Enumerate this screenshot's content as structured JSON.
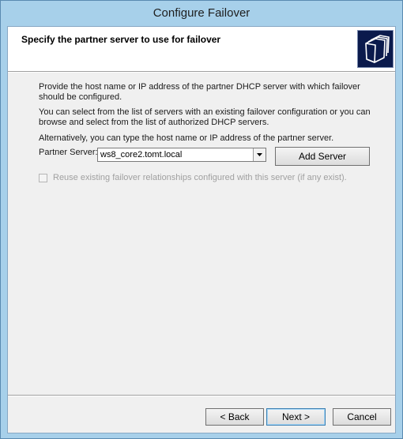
{
  "window": {
    "title": "Configure Failover"
  },
  "header": {
    "title": "Specify the partner server to use for failover",
    "icon": "folders-icon"
  },
  "body": {
    "description1": "Provide the host name or IP address of the partner DHCP server with which failover should be configured.",
    "description2": "You can select from the list of servers with an existing failover configuration or you can browse and select from the list of authorized DHCP servers.",
    "description3": "Alternatively, you can type the host name or IP address of the partner server."
  },
  "partner_server": {
    "label": "Partner Server:",
    "value": "ws8_core2.tomt.local",
    "add_button": "Add Server"
  },
  "reuse": {
    "label": "Reuse existing failover relationships configured with this server (if any exist).",
    "checked": false,
    "enabled": false
  },
  "footer": {
    "back": "< Back",
    "next": "Next >",
    "cancel": "Cancel"
  }
}
